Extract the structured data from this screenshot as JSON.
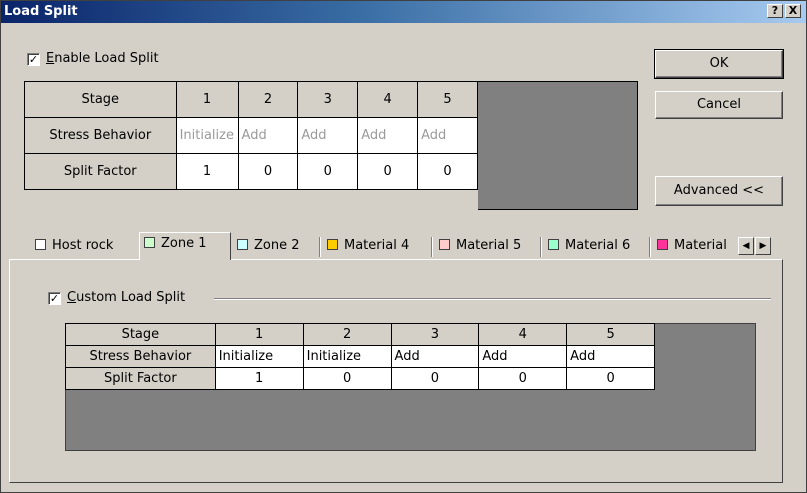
{
  "window": {
    "title": "Load Split",
    "help_button": "?",
    "close_button": "X"
  },
  "enable": {
    "checked": true,
    "check_mark": "✓",
    "label_underlined": "E",
    "label_rest": "nable Load Split"
  },
  "buttons": {
    "ok": "OK",
    "cancel": "Cancel",
    "advanced": "Advanced <<"
  },
  "main_table": {
    "row_labels": [
      "Stage",
      "Stress Behavior",
      "Split Factor"
    ],
    "stages": [
      "1",
      "2",
      "3",
      "4",
      "5"
    ],
    "stress_behavior": [
      "Initialize",
      "Add",
      "Add",
      "Add",
      "Add"
    ],
    "split_factor": [
      "1",
      "0",
      "0",
      "0",
      "0"
    ]
  },
  "tabs": [
    {
      "label": "Host rock",
      "color": "#ffffff"
    },
    {
      "label": "Zone 1",
      "color": "#ccffcc",
      "active": true
    },
    {
      "label": "Zone 2",
      "color": "#ccffff"
    },
    {
      "label": "Material 4",
      "color": "#ffcc00"
    },
    {
      "label": "Material 5",
      "color": "#ffcccc"
    },
    {
      "label": "Material 6",
      "color": "#99ffcc"
    },
    {
      "label": "Material",
      "color": "#ff3399"
    }
  ],
  "tab_scroll": {
    "left": "◀",
    "right": "▶"
  },
  "custom": {
    "checked": true,
    "check_mark": "✓",
    "label_underlined": "C",
    "label_rest": "ustom Load Split"
  },
  "zone_table": {
    "row_labels": [
      "Stage",
      "Stress Behavior",
      "Split Factor"
    ],
    "stages": [
      "1",
      "2",
      "3",
      "4",
      "5"
    ],
    "stress_behavior": [
      "Initialize",
      "Initialize",
      "Add",
      "Add",
      "Add"
    ],
    "split_factor": [
      "1",
      "0",
      "0",
      "0",
      "0"
    ]
  },
  "icons": {
    "check": "check-icon",
    "scroll_left": "arrow-left-icon",
    "scroll_right": "arrow-right-icon",
    "swatch": "color-swatch-icon"
  }
}
